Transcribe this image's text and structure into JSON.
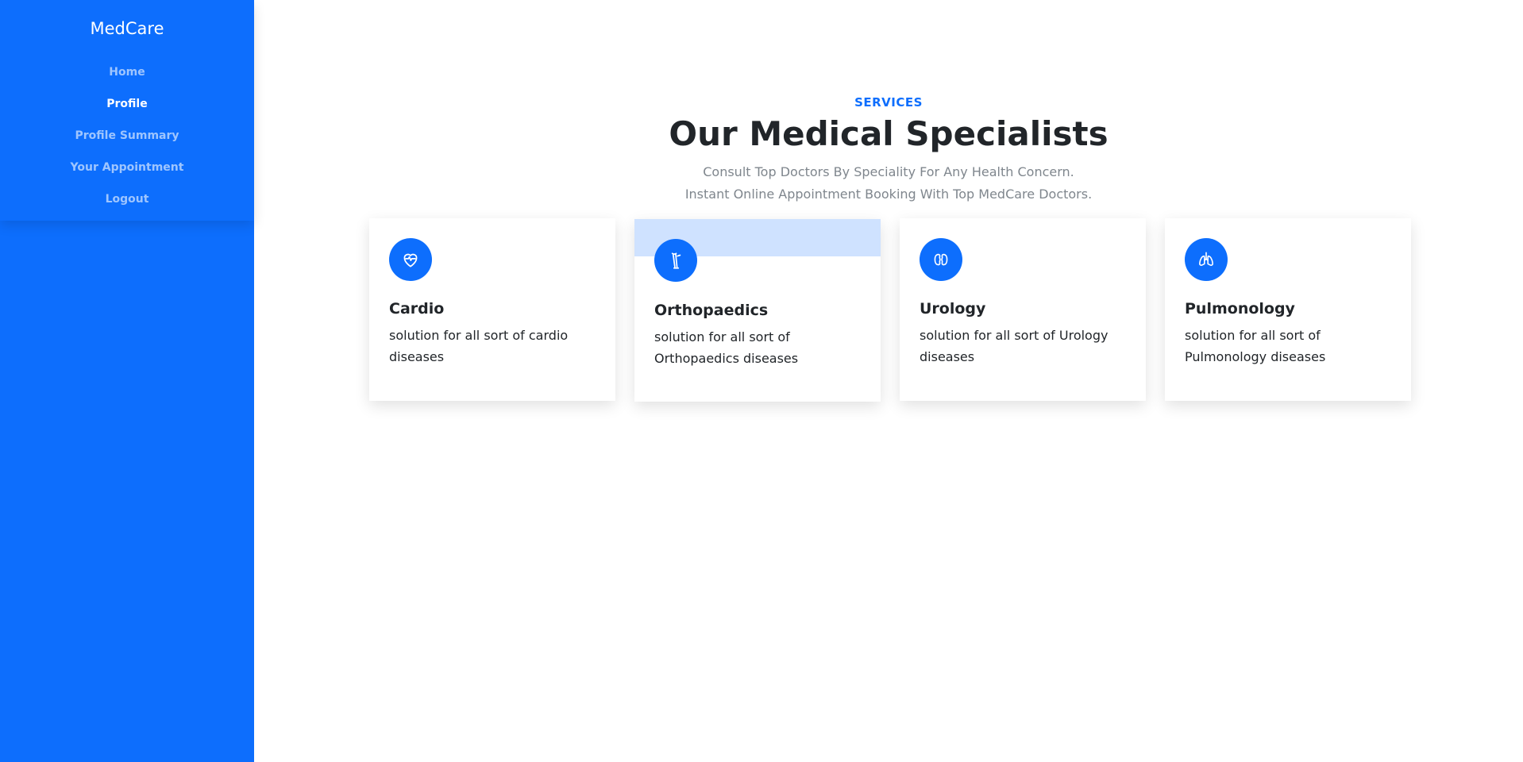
{
  "sidebar": {
    "brand": "MedCare",
    "items": [
      {
        "label": "Home"
      },
      {
        "label": "Profile"
      },
      {
        "label": "Profile Summary"
      },
      {
        "label": "Your Appointment"
      },
      {
        "label": "Logout"
      }
    ],
    "active_index": 1
  },
  "main": {
    "eyebrow": "SERVICES",
    "title": "Our Medical Specialists",
    "subtitle_line1": "Consult Top Doctors By Speciality For Any Health Concern.",
    "subtitle_line2": "Instant Online Appointment Booking With Top MedCare Doctors.",
    "cards": [
      {
        "title": "Cardio",
        "text": "solution for all sort of cardio diseases",
        "icon": "heart-icon"
      },
      {
        "title": "Orthopaedics",
        "text": "solution for all sort of Orthopaedics diseases",
        "icon": "bone-icon"
      },
      {
        "title": "Urology",
        "text": "solution for all sort of Urology diseases",
        "icon": "kidney-icon"
      },
      {
        "title": "Pulmonology",
        "text": "solution for all sort of Pulmonology diseases",
        "icon": "lungs-icon"
      }
    ]
  },
  "colors": {
    "accent": "#0d6efd",
    "highlight_band": "#cfe2ff",
    "heading": "#212529",
    "muted": "#7f868d"
  }
}
